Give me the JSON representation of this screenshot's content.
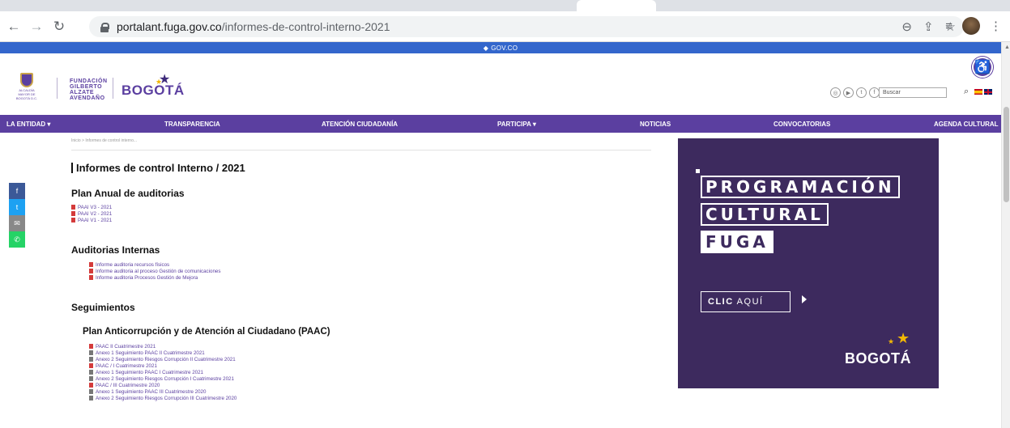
{
  "browser": {
    "url_domain": "portalant.fuga.gov.co",
    "url_path": "/informes-de-control-interno-2021"
  },
  "govbar": {
    "label": "GOV.CO"
  },
  "header": {
    "org_line1": "FUNDACIÓN",
    "org_line2": "GILBERTO",
    "org_line3": "ALZATE",
    "org_line4": "AVENDAÑO",
    "bogota": "BOGOTÁ",
    "escudo_caption": "ALCALDÍA MAYOR DE BOGOTÁ D.C.",
    "search_placeholder": "Buscar"
  },
  "nav": {
    "items": [
      "LA ENTIDAD ▾",
      "TRANSPARENCIA",
      "ATENCIÓN CIUDADANÍA",
      "PARTICIPA ▾",
      "NOTICIAS",
      "CONVOCATORIAS",
      "AGENDA CULTURAL"
    ]
  },
  "content": {
    "breadcrumb": "Inicio > Informes de control interno...",
    "title": "Informes de control Interno / 2021",
    "section1": "Plan Anual de auditorias",
    "section1_links": [
      "PAAI V3 - 2021",
      "PAAI V2 - 2021",
      "PAAI V1 - 2021"
    ],
    "section2": "Auditorias Internas",
    "section2_links": [
      "Informe auditoria recursos físicos",
      "Informe auditoria al proceso Gestión de comunicaciones",
      "Informe auditoria Procesos Gestión de Mejora"
    ],
    "section3": "Seguimientos",
    "subsection": "Plan Anticorrupción y de Atención al Ciudadano (PAAC)",
    "subsection_links": [
      "PAAC II Cuatrimestre 2021",
      "Anexo 1 Seguimiento PAAC II Cuatrimestre 2021",
      "Anexo 2 Seguimiento Riesgos Corrupción II Cuatrimestre 2021",
      "PAAC / I Cuatrimestre 2021",
      "Anexo 1 Seguimiento PAAC I Cuatrimestre 2021",
      "Anexo 2 Seguimiento Riesgos Corrupción I Cuatrimestre 2021",
      "PAAC / III Cuatrimestre 2020",
      "Anexo 1 Seguimiento PAAC III Cuatrimestre 2020",
      "Anexo 2 Seguimiento Riesgos Corrupción III Cuatrimestre 2020"
    ]
  },
  "banner": {
    "line1": "PROGRAMACIÓN",
    "line2": "CULTURAL",
    "line3": "FUGA",
    "clic": "CLIC",
    "aqui": "AQUÍ",
    "bogota": "BOGOTÁ"
  },
  "colors": {
    "brand_purple": "#5b3fa0",
    "banner_bg": "#3d2a5e",
    "gov_blue": "#3366cc"
  }
}
